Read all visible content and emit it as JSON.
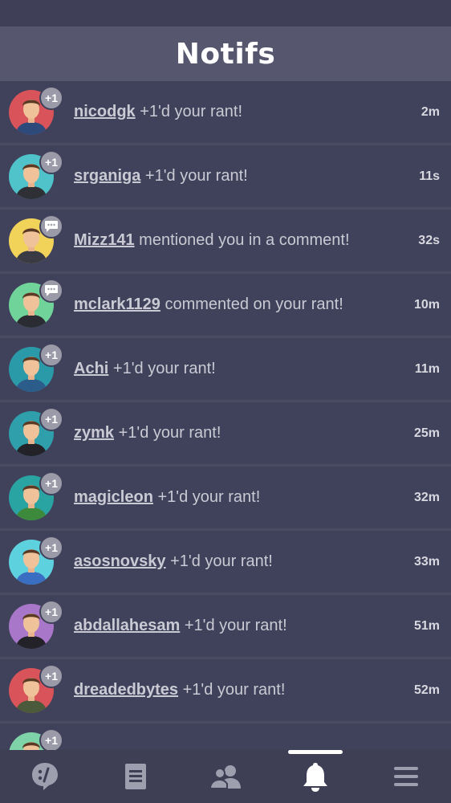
{
  "header": {
    "title": "Notifs"
  },
  "notifications": [
    {
      "user": "nicodgk",
      "action": "+1'd your rant!",
      "time": "2m",
      "badge": "+1",
      "badge_type": "plus-one",
      "avatar_color": "#d9545a",
      "shirt": "#2d4a7a"
    },
    {
      "user": "srganiga",
      "action": "+1'd your rant!",
      "time": "11s",
      "badge": "+1",
      "badge_type": "plus-one",
      "avatar_color": "#4fc3c9",
      "shirt": "#2f2f36"
    },
    {
      "user": "Mizz141",
      "action": "mentioned you in a comment!",
      "time": "32s",
      "badge": "",
      "badge_type": "comment",
      "avatar_color": "#f2d35a",
      "shirt": "#3a3a44"
    },
    {
      "user": "mclark1129",
      "action": "commented on your rant!",
      "time": "10m",
      "badge": "",
      "badge_type": "comment",
      "avatar_color": "#6fd39a",
      "shirt": "#2b2b33"
    },
    {
      "user": "Achi",
      "action": "+1'd your rant!",
      "time": "11m",
      "badge": "+1",
      "badge_type": "plus-one",
      "avatar_color": "#2b9aa8",
      "shirt": "#2c5c8a"
    },
    {
      "user": "zymk",
      "action": "+1'd your rant!",
      "time": "25m",
      "badge": "+1",
      "badge_type": "plus-one",
      "avatar_color": "#2e9fab",
      "shirt": "#222228"
    },
    {
      "user": "magicleon",
      "action": "+1'd your rant!",
      "time": "32m",
      "badge": "+1",
      "badge_type": "plus-one",
      "avatar_color": "#2aa3a3",
      "shirt": "#3d8a3d"
    },
    {
      "user": "asosnovsky",
      "action": "+1'd your rant!",
      "time": "33m",
      "badge": "+1",
      "badge_type": "plus-one",
      "avatar_color": "#5ed1df",
      "shirt": "#3a6ec2"
    },
    {
      "user": "abdallahesam",
      "action": "+1'd your rant!",
      "time": "51m",
      "badge": "+1",
      "badge_type": "plus-one",
      "avatar_color": "#a877c9",
      "shirt": "#222228"
    },
    {
      "user": "dreadedbytes",
      "action": "+1'd your rant!",
      "time": "52m",
      "badge": "+1",
      "badge_type": "plus-one",
      "avatar_color": "#d9545a",
      "shirt": "#4a5a3a"
    },
    {
      "user": "",
      "action": "",
      "time": "",
      "badge": "+1",
      "badge_type": "plus-one",
      "avatar_color": "#7fd3a8",
      "shirt": "#333"
    }
  ],
  "tabbar": {
    "tabs": [
      {
        "name": "rants",
        "icon": "devrant-logo-icon"
      },
      {
        "name": "stories",
        "icon": "document-icon"
      },
      {
        "name": "collabs",
        "icon": "users-icon"
      },
      {
        "name": "notifs",
        "icon": "bell-icon",
        "active": true
      },
      {
        "name": "menu",
        "icon": "hamburger-icon"
      }
    ]
  },
  "colors": {
    "background": "#40415a",
    "header": "#56576f",
    "badge": "#9a9aa8",
    "text": "#c9cad4"
  }
}
